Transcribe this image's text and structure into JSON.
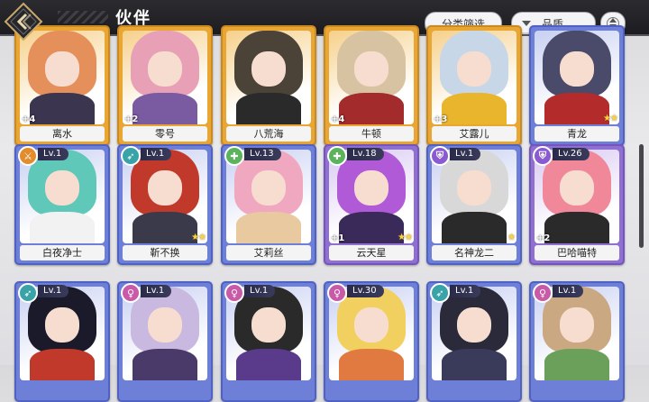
{
  "header": {
    "title": "伙伴",
    "filter_label": "分类筛选",
    "quality_label": "品质"
  },
  "colors": {
    "gold_card": "#e9a633",
    "blue_card": "#6e7fd8",
    "purple_card": "#8f6fd0",
    "header_bg": "#1c1c20"
  },
  "rows": [
    [
      {
        "name": "离水",
        "plus": "+4",
        "stars": "",
        "level": "",
        "class_icon": "",
        "tier": "gold",
        "hair": "#e58f5a",
        "outfit": "#3b3550"
      },
      {
        "name": "零号",
        "plus": "+2",
        "stars": "",
        "level": "",
        "class_icon": "",
        "tier": "gold",
        "hair": "#e7a0b5",
        "outfit": "#7a5aa0"
      },
      {
        "name": "八荒海",
        "plus": "",
        "stars": "",
        "level": "",
        "class_icon": "",
        "tier": "gold",
        "hair": "#4b4238",
        "outfit": "#2a2a2a"
      },
      {
        "name": "牛顿",
        "plus": "+4",
        "stars": "",
        "level": "",
        "class_icon": "",
        "tier": "gold",
        "hair": "#d7c3a2",
        "outfit": "#a42b2b"
      },
      {
        "name": "艾露儿",
        "plus": "+3",
        "stars": "",
        "level": "",
        "class_icon": "",
        "tier": "gold",
        "hair": "#c7d7e8",
        "outfit": "#e8b52d"
      },
      {
        "name": "青龙",
        "plus": "",
        "stars": "★★",
        "level": "",
        "class_icon": "",
        "tier": "blue",
        "hair": "#4a4a6a",
        "outfit": "#b32b2b"
      }
    ],
    [
      {
        "name": "白夜净士",
        "plus": "",
        "stars": "",
        "level": "Lv.1",
        "class_icon": "sword-icon",
        "tier": "blue",
        "hair": "#5fc8b8",
        "outfit": "#f2f2f2",
        "icon_color": "#e28c2b"
      },
      {
        "name": "靳不换",
        "plus": "",
        "stars": "★★",
        "level": "Lv.1",
        "class_icon": "bow-icon",
        "tier": "blue",
        "hair": "#c0392b",
        "outfit": "#3a3a4a",
        "icon_color": "#3aa3a8"
      },
      {
        "name": "艾莉丝",
        "plus": "",
        "stars": "",
        "level": "Lv.13",
        "class_icon": "heal-icon",
        "tier": "blue",
        "hair": "#f0a8c0",
        "outfit": "#e8c9a0",
        "icon_color": "#5bb35b"
      },
      {
        "name": "云天星",
        "plus": "+1",
        "stars": "★★",
        "level": "Lv.18",
        "class_icon": "heal-icon",
        "tier": "purple",
        "hair": "#b05ad8",
        "outfit": "#3a2a5a",
        "icon_color": "#5bb35b"
      },
      {
        "name": "名神龙二",
        "plus": "",
        "stars": "★",
        "level": "Lv.1",
        "class_icon": "shield-icon",
        "tier": "blue",
        "hair": "#d8d8d8",
        "outfit": "#2a2a2a",
        "icon_color": "#8a5ad0"
      },
      {
        "name": "巴哈喵特",
        "plus": "+2",
        "stars": "",
        "level": "Lv.26",
        "class_icon": "shield-icon",
        "tier": "purple",
        "hair": "#f0889a",
        "outfit": "#2a2a2a",
        "icon_color": "#8a5ad0"
      }
    ],
    [
      {
        "name": "",
        "plus": "",
        "stars": "",
        "level": "Lv.1",
        "class_icon": "bow-icon",
        "tier": "blue",
        "hair": "#1a1a2a",
        "outfit": "#c0392b",
        "icon_color": "#3aa3a8"
      },
      {
        "name": "",
        "plus": "",
        "stars": "",
        "level": "Lv.1",
        "class_icon": "female-icon",
        "tier": "blue",
        "hair": "#c9b8e0",
        "outfit": "#4a3a6a",
        "icon_color": "#c85aa8"
      },
      {
        "name": "",
        "plus": "",
        "stars": "",
        "level": "Lv.1",
        "class_icon": "female-icon",
        "tier": "blue",
        "hair": "#2a2a2a",
        "outfit": "#5a3a8a",
        "icon_color": "#c85aa8"
      },
      {
        "name": "",
        "plus": "",
        "stars": "",
        "level": "Lv.30",
        "class_icon": "female-icon",
        "tier": "blue",
        "hair": "#f2d060",
        "outfit": "#e07a40",
        "icon_color": "#c85aa8"
      },
      {
        "name": "",
        "plus": "",
        "stars": "",
        "level": "Lv.1",
        "class_icon": "bow-icon",
        "tier": "blue",
        "hair": "#2a2a3a",
        "outfit": "#3a3a5a",
        "icon_color": "#3aa3a8"
      },
      {
        "name": "",
        "plus": "",
        "stars": "",
        "level": "Lv.1",
        "class_icon": "female-icon",
        "tier": "blue",
        "hair": "#c9a882",
        "outfit": "#6aa05a",
        "icon_color": "#c85aa8"
      }
    ]
  ]
}
